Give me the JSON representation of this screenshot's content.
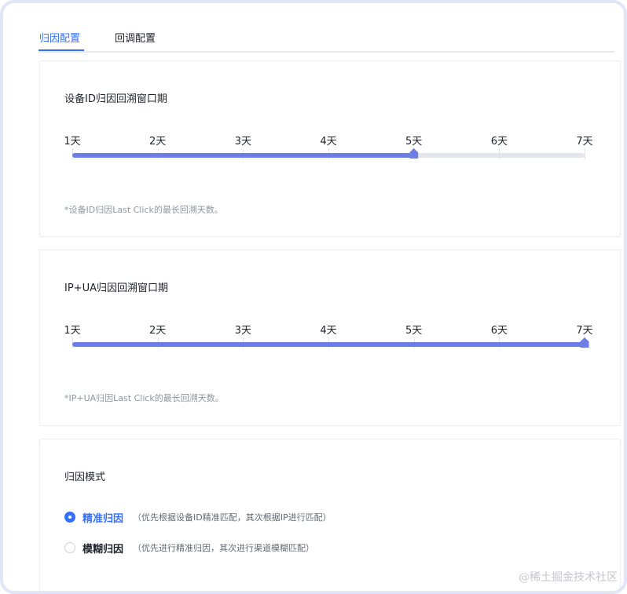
{
  "tabs": [
    {
      "label": "归因配置",
      "active": true
    },
    {
      "label": "回调配置",
      "active": false
    }
  ],
  "device_window": {
    "title": "设备ID归因回溯窗口期",
    "ticks": [
      "1天",
      "2天",
      "3天",
      "4天",
      "5天",
      "6天",
      "7天"
    ],
    "selected_days": 5,
    "hint": "*设备ID归因Last Click的最长回溯天数。"
  },
  "ipua_window": {
    "title": "IP+UA归因回溯窗口期",
    "ticks": [
      "1天",
      "2天",
      "3天",
      "4天",
      "5天",
      "6天",
      "7天"
    ],
    "selected_days": 7,
    "hint": "*IP+UA归因Last Click的最长回溯天数。"
  },
  "attribution_mode": {
    "title": "归因模式",
    "options": [
      {
        "label": "精准归因",
        "desc": "（优先根据设备ID精准匹配，其次根据IP进行匹配）",
        "checked": true
      },
      {
        "label": "模糊归因",
        "desc": "（优先进行精准归因，其次进行渠道模糊匹配）",
        "checked": false
      }
    ]
  },
  "watermark": "@稀土掘金技术社区",
  "colors": {
    "accent": "#3370ff",
    "slider_fill": "#6c7ee6",
    "slider_rail": "#e5e6eb"
  }
}
